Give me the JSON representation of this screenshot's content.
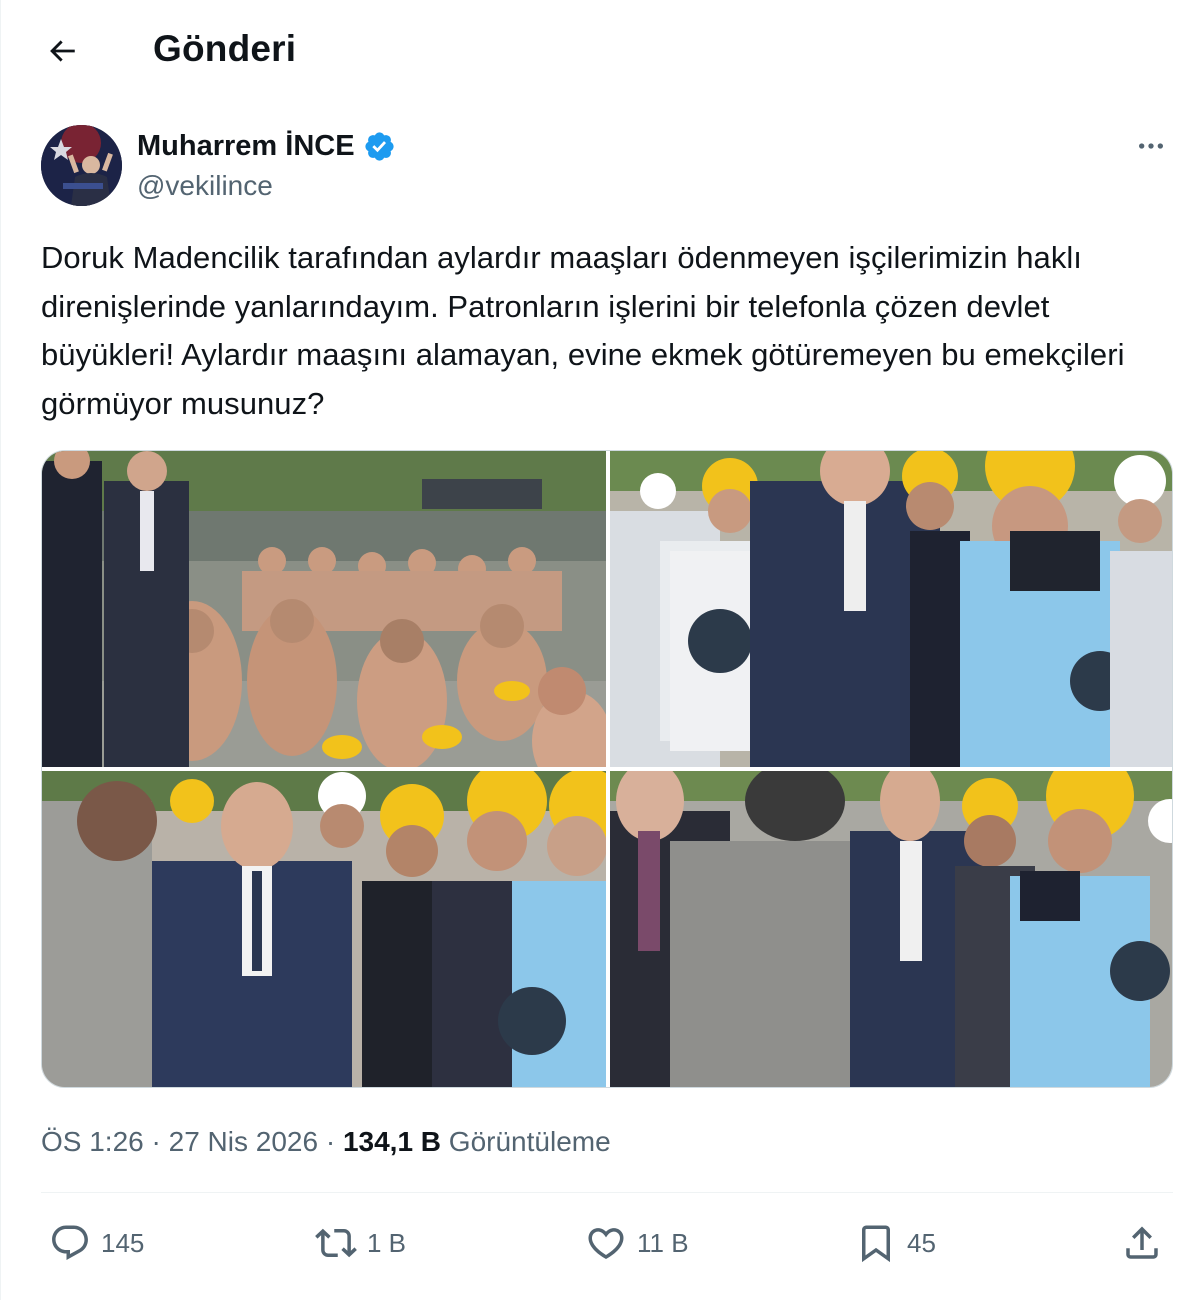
{
  "header": {
    "title": "Gönderi"
  },
  "author": {
    "name": "Muharrem İNCE",
    "handle": "@vekilince"
  },
  "tweet": {
    "text": "Doruk Madencilik tarafından aylardır maaşları ödenmeyen işçilerimizin haklı direnişlerinde yanlarındayım. Patronların işlerini bir telefonla çözen devlet büyükleri! Aylardır maaşını alamayan, evine ekmek götüremeyen bu emekçileri görmüyor musunuz?"
  },
  "meta": {
    "time": "ÖS 1:26",
    "sep1": " · ",
    "date": "27 Nis 2026",
    "sep2": " · ",
    "views_count": "134,1 B",
    "views_label": " Görüntüleme"
  },
  "actions": {
    "reply_count": "145",
    "retweet_count": "1 B",
    "like_count": "11 B",
    "bookmark_count": "45"
  },
  "colors": {
    "text": "#0f1419",
    "secondary": "#536471",
    "verified": "#1d9bf0",
    "divider": "#eff3f4"
  },
  "icons": [
    "back-arrow-icon",
    "verified-badge-icon",
    "more-icon",
    "reply-icon",
    "retweet-icon",
    "like-icon",
    "bookmark-icon",
    "share-icon"
  ]
}
